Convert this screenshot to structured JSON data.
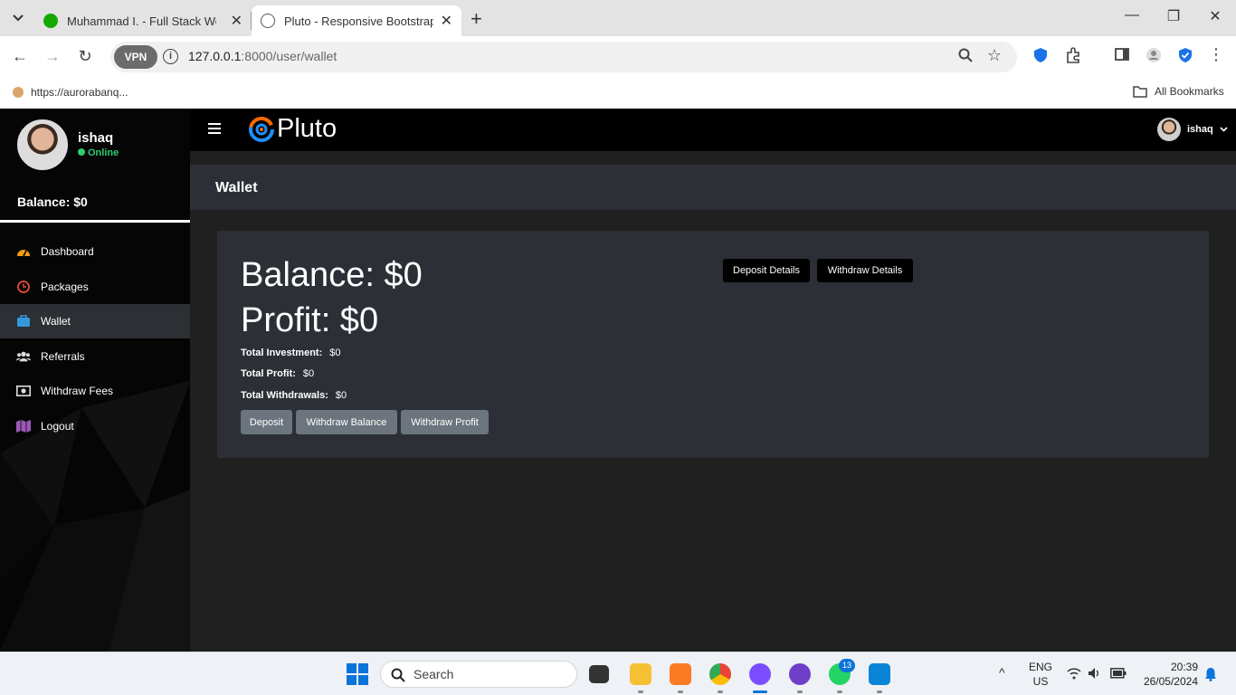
{
  "browser": {
    "tabs": [
      {
        "title": "Muhammad I. - Full Stack Web D",
        "favicon": "upwork-icon"
      },
      {
        "title": "Pluto - Responsive Bootstrap Ad",
        "favicon": "globe-icon"
      }
    ],
    "vpn_label": "VPN",
    "url_host": "127.0.0.1",
    "url_path": ":8000/user/wallet",
    "bookmark_item": "https://aurorabanq...",
    "bookmarks_folder": "All Bookmarks"
  },
  "app": {
    "brand": "Pluto",
    "user": {
      "name": "ishaq",
      "status": "Online"
    },
    "sidebar_balance": "Balance: $0",
    "menu": [
      {
        "label": "Dashboard",
        "icon": "dashboard-icon"
      },
      {
        "label": "Packages",
        "icon": "clock-icon"
      },
      {
        "label": "Wallet",
        "icon": "briefcase-icon"
      },
      {
        "label": "Referrals",
        "icon": "users-icon"
      },
      {
        "label": "Withdraw Fees",
        "icon": "money-icon"
      },
      {
        "label": "Logout",
        "icon": "map-icon"
      }
    ],
    "topbar_user": "ishaq"
  },
  "page": {
    "title": "Wallet",
    "balance": "Balance: $0",
    "profit": "Profit: $0",
    "stats": [
      {
        "label": "Total Investment:",
        "value": "$0"
      },
      {
        "label": "Total Profit:",
        "value": "$0"
      },
      {
        "label": "Total Withdrawals:",
        "value": "$0"
      }
    ],
    "actions": [
      "Deposit",
      "Withdraw Balance",
      "Withdraw Profit"
    ],
    "detail_buttons": [
      "Deposit Details",
      "Withdraw Details"
    ]
  },
  "taskbar": {
    "search_placeholder": "Search",
    "whatsapp_badge": "13",
    "lang_top": "ENG",
    "lang_bottom": "US",
    "time": "20:39",
    "date": "26/05/2024"
  },
  "colors": {
    "sidebar_bg": "#050505",
    "panel_bg": "#2c3036",
    "content_bg": "#202020",
    "online_green": "#2ecc71",
    "button_grey": "#6c757d"
  }
}
